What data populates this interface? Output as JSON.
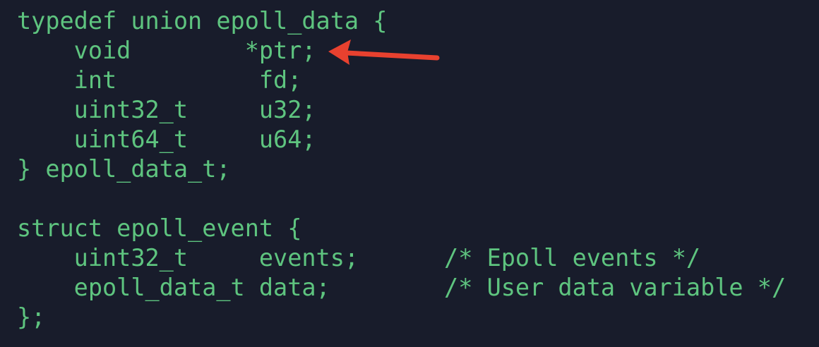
{
  "code": {
    "lines": [
      "typedef union epoll_data {",
      "    void        *ptr;",
      "    int          fd;",
      "    uint32_t     u32;",
      "    uint64_t     u64;",
      "} epoll_data_t;",
      "",
      "struct epoll_event {",
      "    uint32_t     events;      /* Epoll events */",
      "    epoll_data_t data;        /* User data variable */",
      "};"
    ]
  },
  "colors": {
    "background": "#181c2b",
    "code_text": "#5ec47f",
    "annotation_arrow": "#e8412f"
  }
}
